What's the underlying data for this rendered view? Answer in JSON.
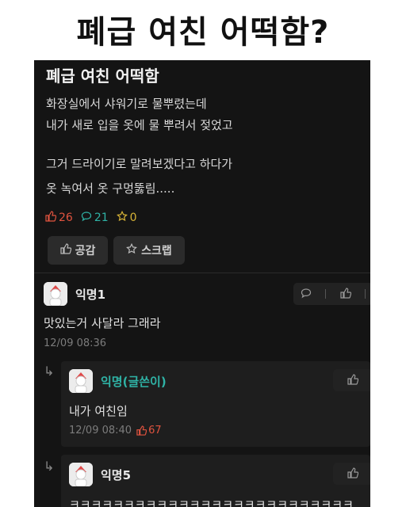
{
  "headline": "폐급 여친 어떡함?",
  "post": {
    "title": "폐급 여친 어떡함",
    "body_lines": [
      "화장실에서 샤워기로 물뿌렸는데",
      "내가 새로 입을 옷에 물 뿌려서 젖었고",
      "그거 드라이기로 말려보겠다고 하다가",
      "옷 녹여서 옷 구멍뚫림....."
    ],
    "likes": "26",
    "comments": "21",
    "scraps": "0",
    "like_button": "공감",
    "scrap_button": "스크랩"
  },
  "comments": [
    {
      "nick": "익명1",
      "text": "맛있는거 사달라 그래라",
      "time": "12/09 08:36",
      "likes": ""
    },
    {
      "nick": "익명(글쓴이)",
      "text": "내가 여친임",
      "time": "12/09 08:40",
      "likes": "67"
    },
    {
      "nick": "익명5",
      "text": "ㅋㅋㅋㅋㅋㅋㅋㅋㅋㅋㅋㅋㅋㅋㅋㅋㅋㅋㅋㅋㅋㅋㅋㅋㅋㅋ"
    }
  ],
  "colors": {
    "background": "#141414",
    "like": "#e0533f",
    "comment": "#2fb3a6",
    "scrap": "#d8b437",
    "author": "#2fb3a6"
  }
}
